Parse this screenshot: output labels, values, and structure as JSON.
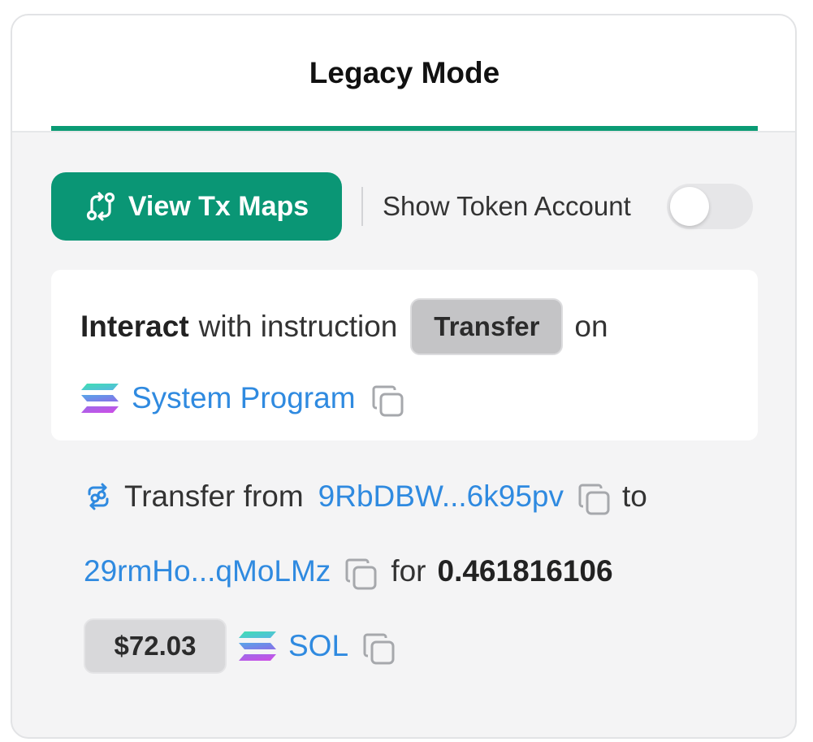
{
  "tab": {
    "label": "Legacy Mode"
  },
  "toolbar": {
    "view_tx_maps_label": "View Tx Maps",
    "show_token_account_label": "Show Token Account",
    "show_token_account_on": false
  },
  "instruction": {
    "verb": "Interact",
    "text_with_instruction": "with instruction",
    "instruction_name": "Transfer",
    "text_on": "on",
    "program_name": "System Program"
  },
  "transfer": {
    "text_transfer_from": "Transfer from",
    "from_address": "9RbDBW...6k95pv",
    "text_to": "to",
    "to_address": "29rmHo...qMoLMz",
    "text_for": "for",
    "amount": "0.461816106",
    "usd_value": "$72.03",
    "token": "SOL"
  },
  "colors": {
    "accent": "#0a9675",
    "link": "#2f8ae0",
    "card_bg": "#f4f4f5"
  },
  "icons": [
    "tx-maps-icon",
    "solana-logo-icon",
    "copy-icon",
    "transfer-arrows-icon"
  ]
}
